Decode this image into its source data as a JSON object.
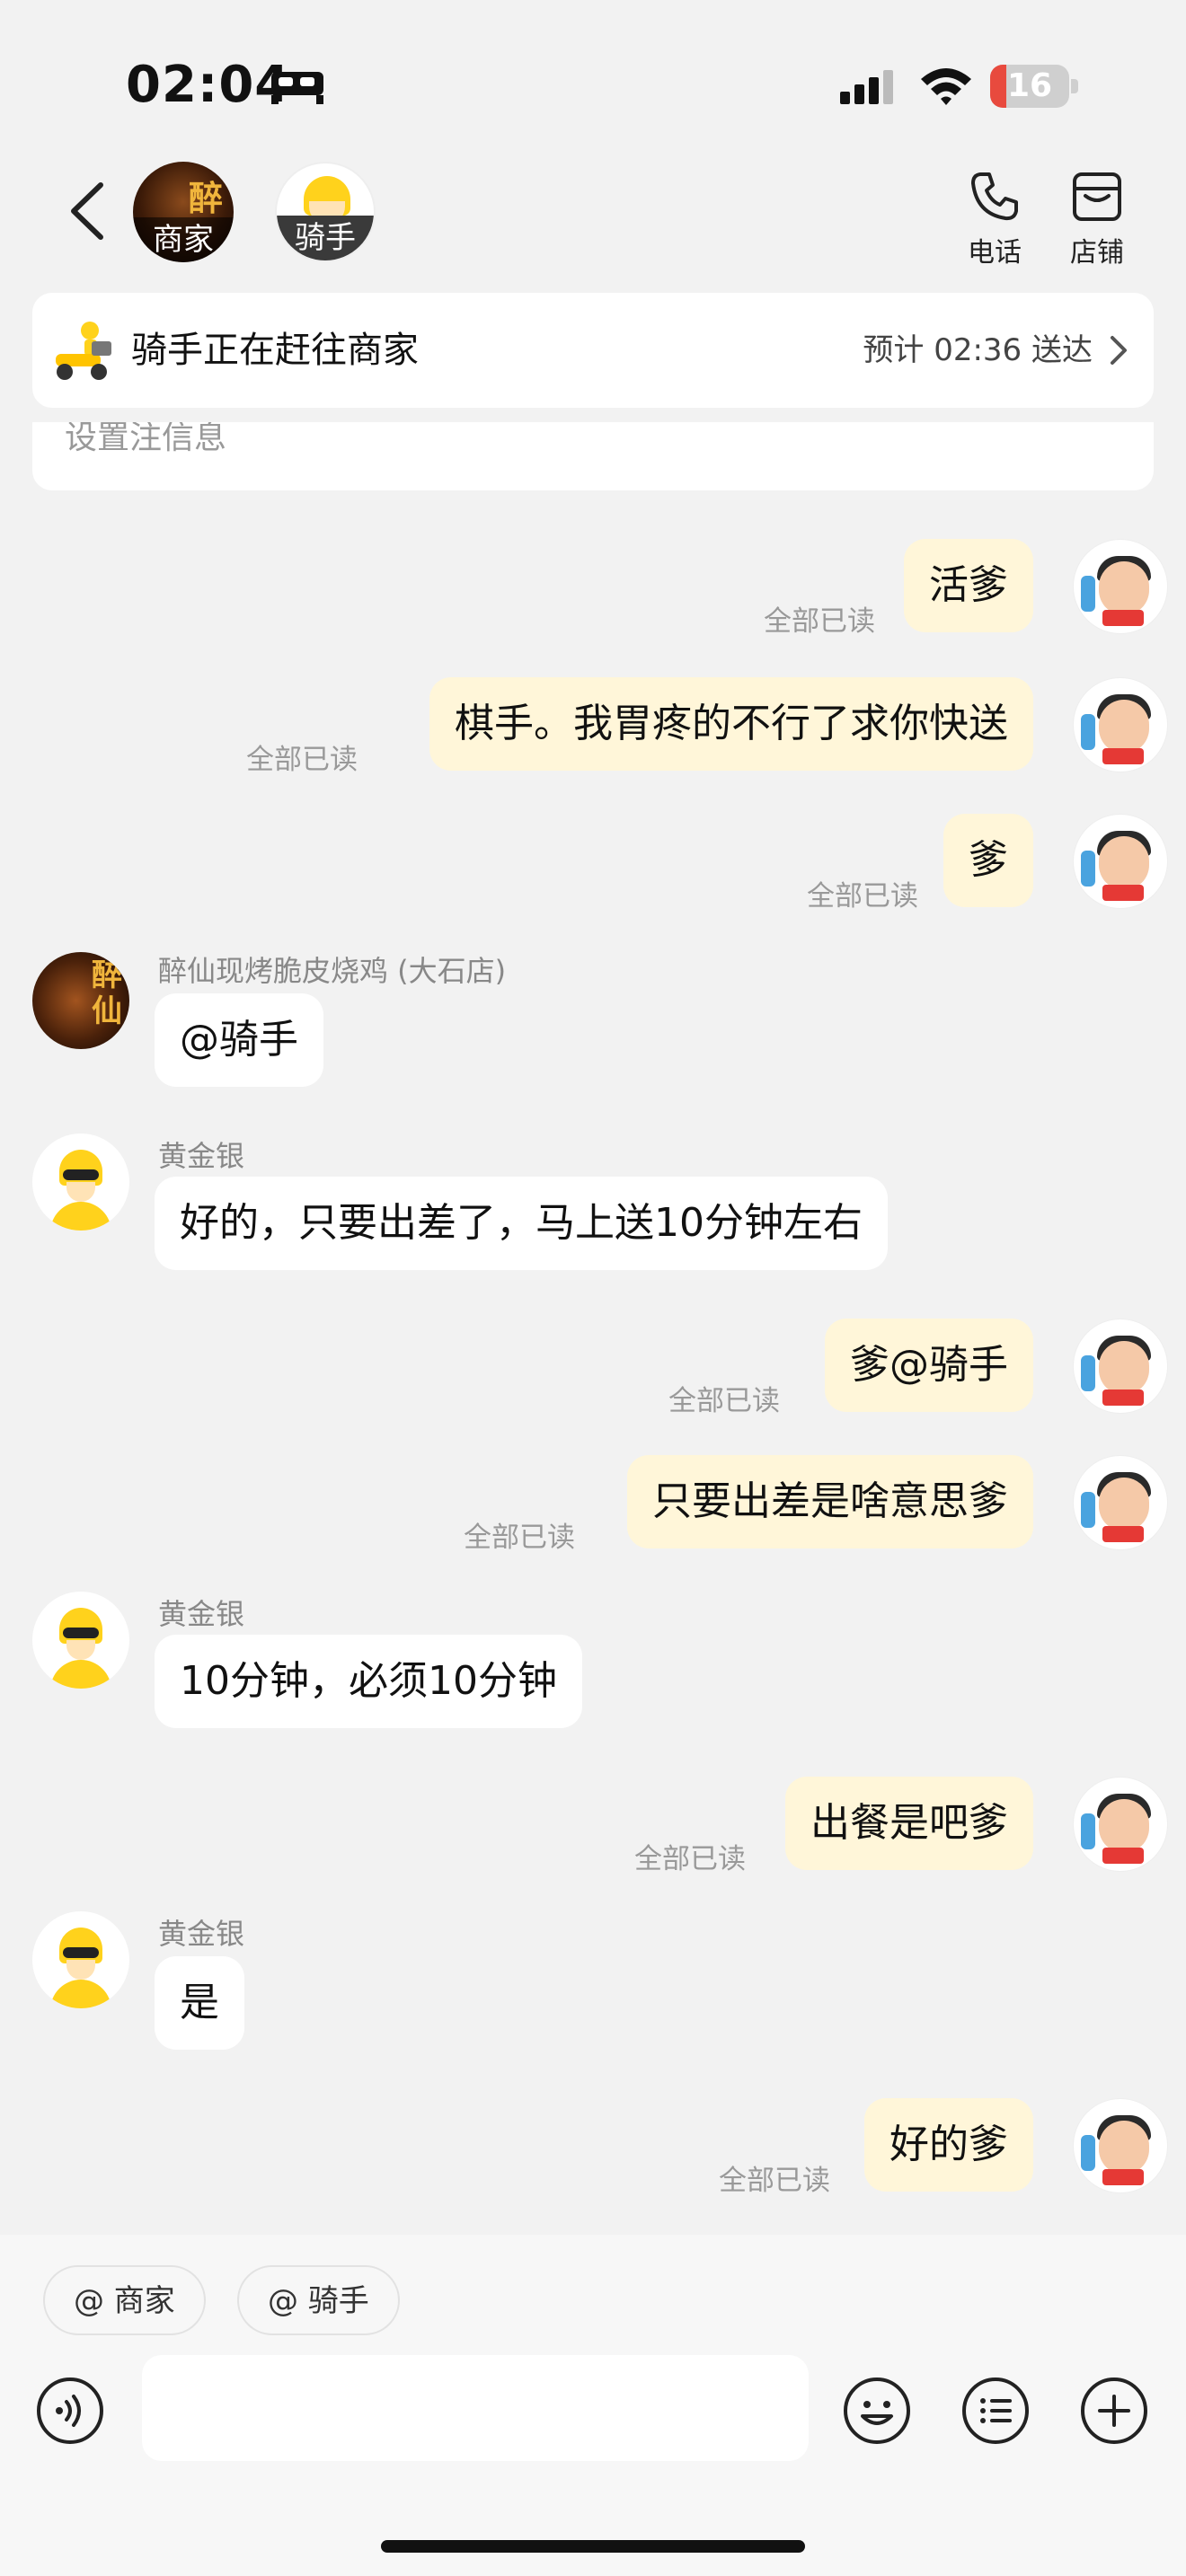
{
  "status_bar": {
    "time": "02:04",
    "battery": "16",
    "battery_color": "#e84a3e"
  },
  "header": {
    "merchant_avatar_label": "商家",
    "merchant_avatar_char": "醉",
    "rider_avatar_label": "骑手",
    "phone_label": "电话",
    "store_label": "店铺"
  },
  "delivery": {
    "status": "骑手正在赶往商家",
    "eta": "预计 02:36 送达"
  },
  "partial_notice": "设置注信息",
  "merchant_avatar_char": "醉仙",
  "messages": [
    {
      "type": "sent",
      "text": "活爹",
      "receipt": "全部已读"
    },
    {
      "type": "sent",
      "text": "棋手。我胃疼的不行了求你快送",
      "receipt": "全部已读"
    },
    {
      "type": "sent",
      "text": "爹",
      "receipt": "全部已读"
    },
    {
      "type": "received",
      "sender": "醉仙现烤脆皮烧鸡 (大石店)",
      "text": "@骑手"
    },
    {
      "type": "received",
      "sender": "黄金银",
      "text": "好的，只要出差了，马上送10分钟左右"
    },
    {
      "type": "sent",
      "text": "爹@骑手",
      "receipt": "全部已读"
    },
    {
      "type": "sent",
      "text": "只要出差是啥意思爹",
      "receipt": "全部已读"
    },
    {
      "type": "received",
      "sender": "黄金银",
      "text": "10分钟，必须10分钟"
    },
    {
      "type": "sent",
      "text": "出餐是吧爹",
      "receipt": "全部已读"
    },
    {
      "type": "received",
      "sender": "黄金银",
      "text": "是"
    },
    {
      "type": "sent",
      "text": "好的爹",
      "receipt": "全部已读"
    }
  ],
  "input": {
    "mention_merchant": "@ 商家",
    "mention_rider": "@ 骑手",
    "placeholder": ""
  },
  "colors": {
    "sent_bubble": "#fff6d9",
    "received_bubble": "#ffffff",
    "background": "#f2f2f2",
    "brand_yellow": "#ffd21c"
  }
}
